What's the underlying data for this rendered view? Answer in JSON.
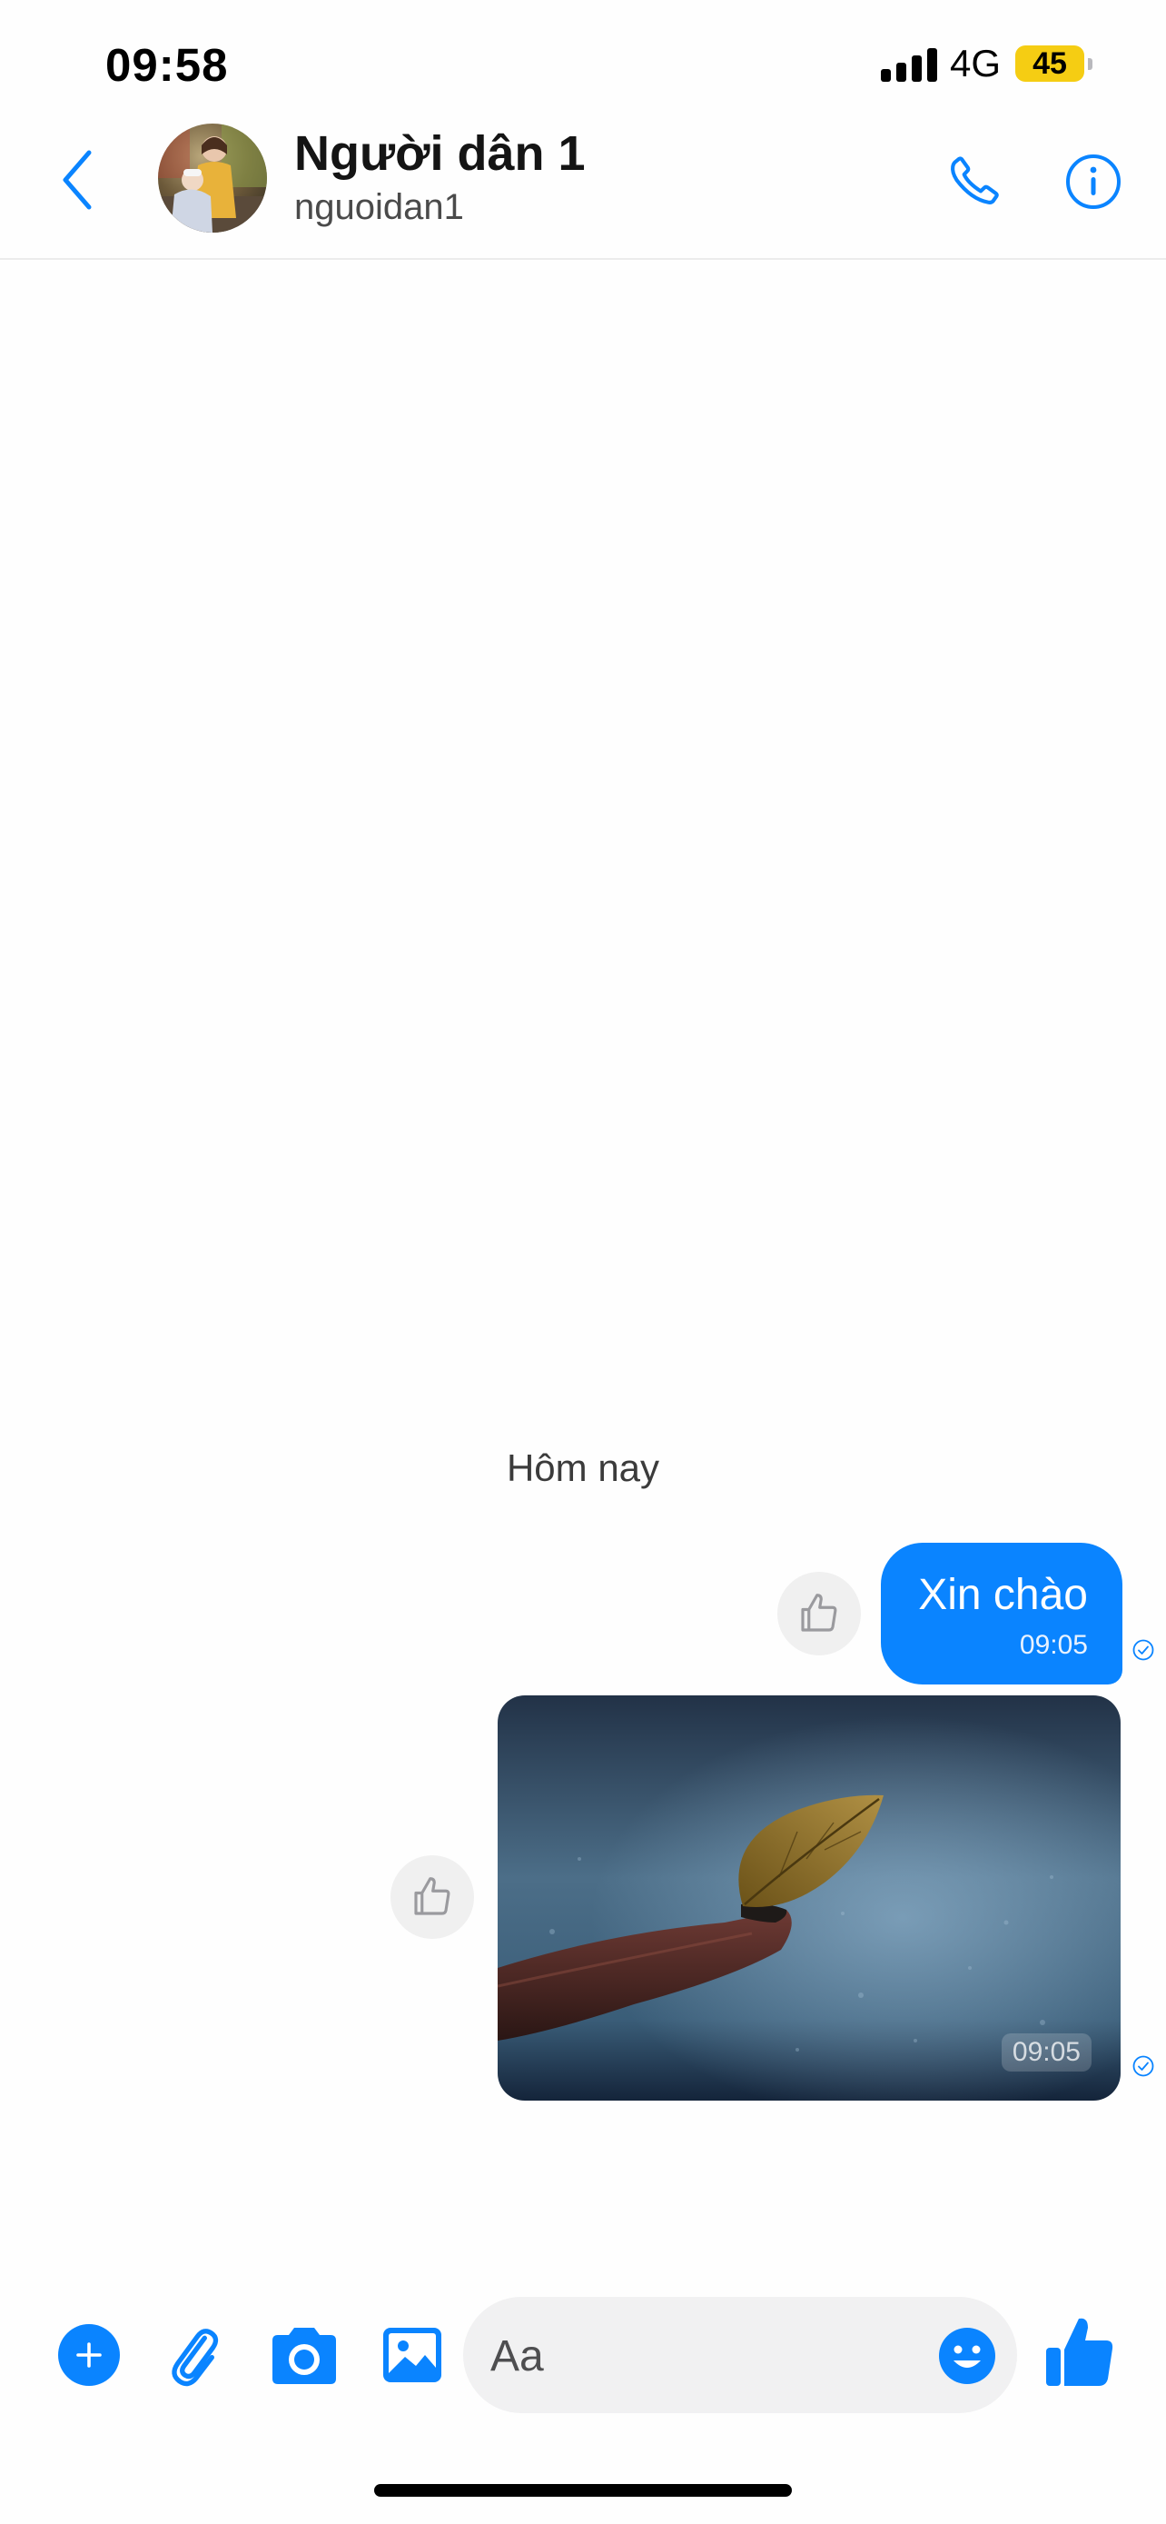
{
  "status_bar": {
    "time": "09:58",
    "network": "4G",
    "battery": "45",
    "battery_color": "#f5cd13"
  },
  "header": {
    "contact_name": "Người dân 1",
    "username": "nguoidan1",
    "icons": [
      "chevron-left-icon",
      "avatar",
      "phone-icon",
      "info-icon"
    ]
  },
  "messages": {
    "day_label": "Hôm nay",
    "items": [
      {
        "type": "text",
        "text": "Xin chào",
        "time": "09:05"
      },
      {
        "type": "image",
        "image": "leaf-on-branch-in-rain-photo",
        "time": "09:05"
      }
    ]
  },
  "composer": {
    "placeholder": "Aa",
    "icons": [
      "plus-icon",
      "paperclip-icon",
      "camera-icon",
      "image-icon",
      "smile-icon",
      "thumbs-up-icon"
    ]
  },
  "colors": {
    "accent": "#0a84ff",
    "bubble_text": "#ffffff",
    "composer_bg": "#f1f1f2"
  }
}
